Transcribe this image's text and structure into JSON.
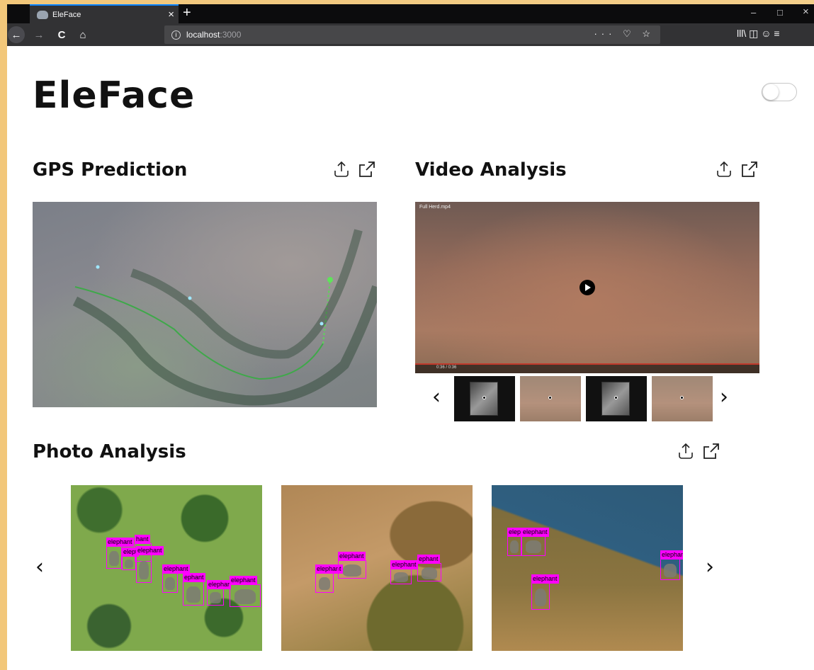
{
  "browser": {
    "tab_title": "EleFace",
    "tab_close": "×",
    "new_tab": "+",
    "url_host": "localhost",
    "url_port": ":3000",
    "url_actions": "··· ♡ ☆",
    "right_tools": "lll\\ ◫ ☺ ≡",
    "win_min": "–",
    "win_max": "□",
    "win_close": "×",
    "back": "←",
    "forward": "→",
    "reload": "C",
    "home": "⌂",
    "info": "i"
  },
  "app": {
    "title": "EleFace"
  },
  "sections": {
    "gps_title": "GPS Prediction",
    "video_title": "Video Analysis",
    "photo_title": "Photo Analysis"
  },
  "video": {
    "filename": "Full Herd.mp4",
    "time": "0:36 / 0:36"
  },
  "carousel": {
    "prev": "‹",
    "next": "›"
  },
  "photos": [
    {
      "labels": [
        "elephant",
        "hant",
        "elept",
        "elephant",
        "elephant",
        "ephant",
        "elephar",
        "elephant"
      ]
    },
    {
      "labels": [
        "elephant",
        "elephant",
        "elephant",
        "ephant"
      ]
    },
    {
      "labels": [
        "elep",
        "elephant",
        "elephant",
        "elephant"
      ]
    }
  ]
}
